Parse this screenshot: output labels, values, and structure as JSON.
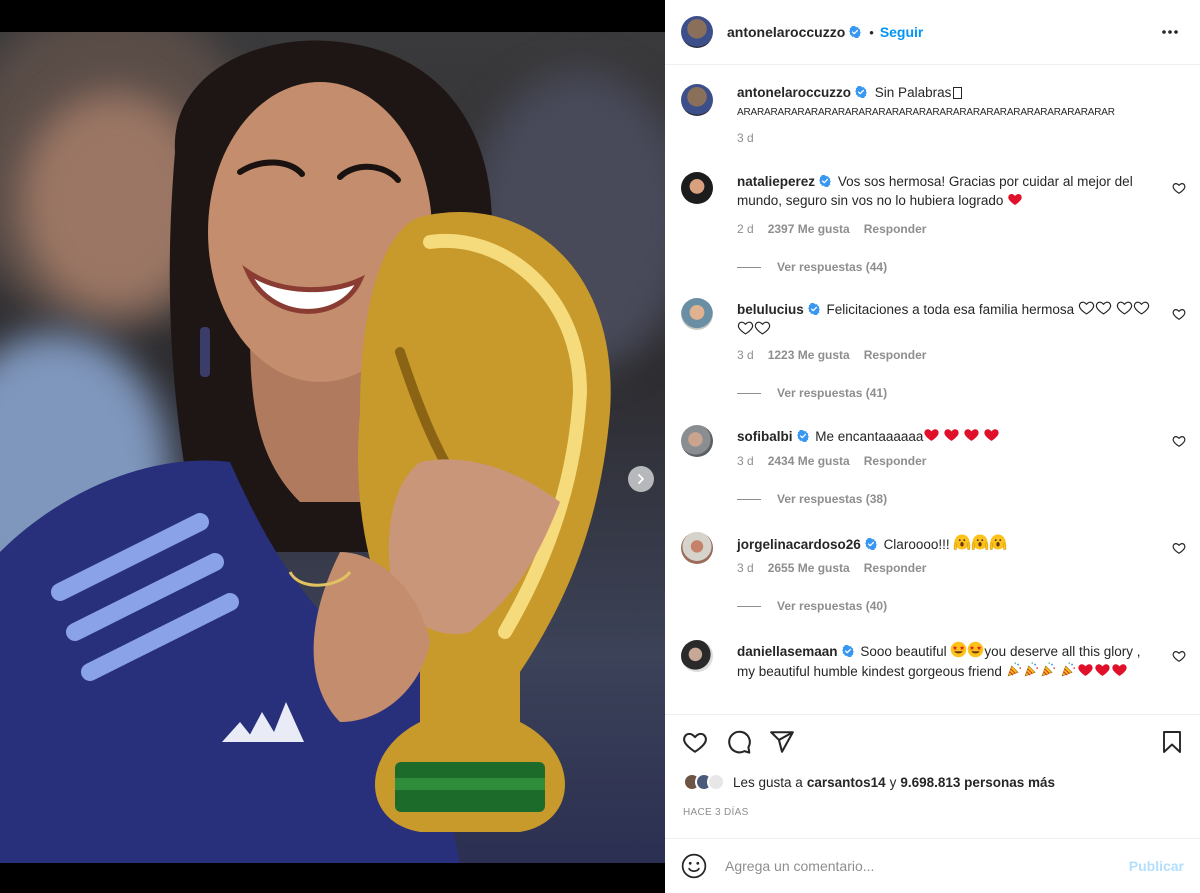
{
  "post": {
    "author": "antonelaroccuzzo",
    "follow_label": "Seguir",
    "separator": "•"
  },
  "caption": {
    "author": "antonelaroccuzzo",
    "text": "Sin Palabras",
    "tail": "ARARARARARARARARARARARARARARARARARARARARARARARARARARARAR",
    "time": "3 d"
  },
  "comments": [
    {
      "username": "natalieperez",
      "text": "Vos sos hermosa! Gracias por cuidar al mejor del mundo, seguro sin vos no lo hubiera logrado",
      "time": "2 d",
      "likes": "2397 Me gusta",
      "reply_label": "Responder",
      "replies": "Ver respuestas (44)"
    },
    {
      "username": "belulucius",
      "text": "Felicitaciones a toda esa familia hermosa",
      "time": "3 d",
      "likes": "1223 Me gusta",
      "reply_label": "Responder",
      "replies": "Ver respuestas (41)"
    },
    {
      "username": "sofibalbi",
      "text": "Me encantaaaaaa",
      "time": "3 d",
      "likes": "2434 Me gusta",
      "reply_label": "Responder",
      "replies": "Ver respuestas (38)"
    },
    {
      "username": "jorgelinacardoso26",
      "text": "Claroooo!!!",
      "time": "3 d",
      "likes": "2655 Me gusta",
      "reply_label": "Responder",
      "replies": "Ver respuestas (40)"
    },
    {
      "username": "daniellasemaan",
      "text_a": "Sooo beautiful",
      "text_b": "you deserve all this glory , my beautiful humble kindest gorgeous friend"
    }
  ],
  "likes": {
    "prefix": "Les gusta a",
    "user": "carsantos14",
    "middle": "y",
    "count": "9.698.813 personas más"
  },
  "time_ago": "HACE 3 DÍAS",
  "composer": {
    "placeholder": "Agrega un comentario...",
    "publish_label": "Publicar"
  },
  "carousel": {
    "slides": 5,
    "active_index": 0
  },
  "colors": {
    "accent": "#0095f6",
    "verified": "#3897f0",
    "heart_red": "#ed4956"
  },
  "icons": [
    "more-icon",
    "verified-icon",
    "heart-outline-icon",
    "comment-icon",
    "share-icon",
    "bookmark-icon",
    "emoji-icon",
    "chevron-right-icon"
  ]
}
